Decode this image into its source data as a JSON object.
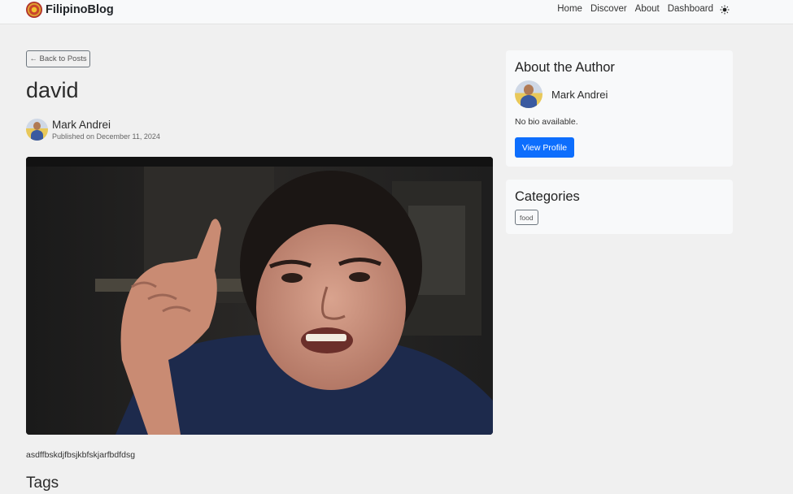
{
  "navbar": {
    "brand": "FilipinoBlog",
    "links": [
      "Home",
      "Discover",
      "About",
      "Dashboard"
    ],
    "theme_icon": "sun-icon"
  },
  "post": {
    "back_label": "← Back to Posts",
    "title": "david",
    "author": "Mark Andrei",
    "published": "Published on December 11, 2024",
    "body": "asdffbskdjfbsjkbfskjarfbdfdsg",
    "tags_heading": "Tags"
  },
  "sidebar": {
    "about_title": "About the Author",
    "author_name": "Mark Andrei",
    "bio": "No bio available.",
    "view_profile": "View Profile",
    "categories_title": "Categories",
    "categories": [
      "food"
    ]
  },
  "colors": {
    "primary": "#0d6efd",
    "background": "#f0f0f0",
    "card": "#f8f9fa"
  }
}
